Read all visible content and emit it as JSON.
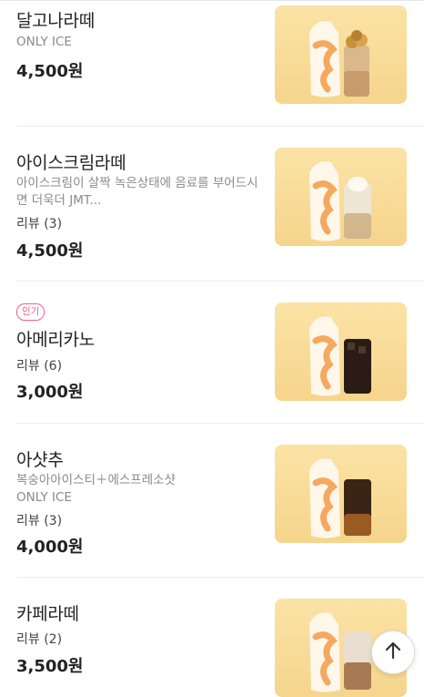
{
  "menu": {
    "items": [
      {
        "name": "달고나라떼",
        "badge": "",
        "desc": "ONLY ICE",
        "review": "",
        "price": "4,500원",
        "drink": "dalgona"
      },
      {
        "name": "아이스크림라떼",
        "badge": "",
        "desc": "아이스크림이 살짝 녹은상태에 음료를 부어드시면 더욱더 JMT...",
        "review": "리뷰 (3)",
        "price": "4,500원",
        "drink": "icecream"
      },
      {
        "name": "아메리카노",
        "badge": "인기",
        "desc": "",
        "review": "리뷰 (6)",
        "price": "3,000원",
        "drink": "americano"
      },
      {
        "name": "아샷추",
        "badge": "",
        "desc": "복숭아아이스티＋에스프레소샷\nONLY ICE",
        "review": "리뷰 (3)",
        "price": "4,000원",
        "drink": "ashotchu"
      },
      {
        "name": "카페라떼",
        "badge": "",
        "desc": "",
        "review": "리뷰 (2)",
        "price": "3,500원",
        "drink": "latte"
      }
    ]
  },
  "scroll_top": {
    "icon": "arrow-up-icon"
  }
}
